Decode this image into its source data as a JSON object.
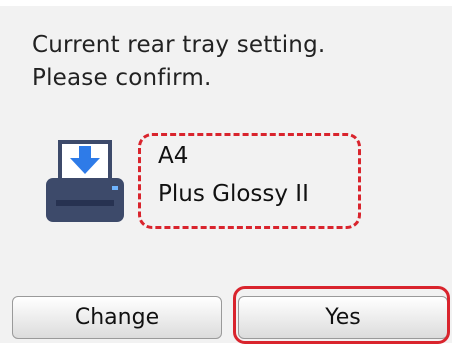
{
  "message": {
    "line1": "Current rear tray setting.",
    "line2": "Please confirm."
  },
  "paper": {
    "size": "A4",
    "type": "Plus Glossy II"
  },
  "buttons": {
    "change": "Change",
    "yes": "Yes"
  },
  "icons": {
    "printer": "printer-rear-tray-icon"
  },
  "colors": {
    "highlight": "#d9242d",
    "arrow": "#2e7be8",
    "printer_body": "#3d4a6a"
  }
}
